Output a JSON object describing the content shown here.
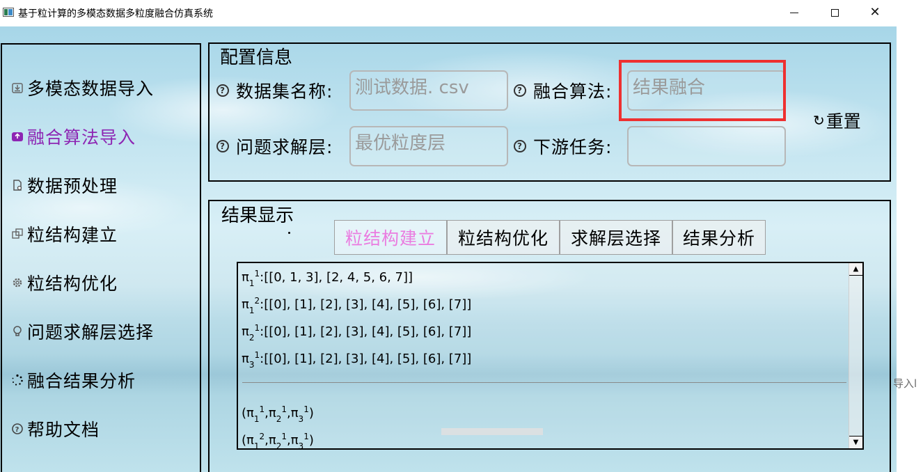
{
  "window": {
    "title": "基于粒计算的多模态数据多粒度融合仿真系统",
    "controls": {
      "minimize": "",
      "maximize": "",
      "close": "✕"
    }
  },
  "nav": {
    "items": [
      {
        "label": "多模态数据导入",
        "icon": "import-icon",
        "active": false
      },
      {
        "label": "融合算法导入",
        "icon": "upload-icon",
        "active": true
      },
      {
        "label": "数据预处理",
        "icon": "file-process-icon",
        "active": false
      },
      {
        "label": "粒结构建立",
        "icon": "structure-icon",
        "active": false
      },
      {
        "label": "粒结构优化",
        "icon": "gear-icon",
        "active": false
      },
      {
        "label": "问题求解层选择",
        "icon": "bulb-icon",
        "active": false
      },
      {
        "label": "融合结果分析",
        "icon": "loading-icon",
        "active": false
      },
      {
        "label": "帮助文档",
        "icon": "help-icon",
        "active": false
      }
    ]
  },
  "config": {
    "title": "配置信息",
    "fields": {
      "dataset": {
        "label": "数据集名称:",
        "value": "测试数据. csv"
      },
      "algorithm": {
        "label": "融合算法:",
        "value": "结果融合"
      },
      "layer": {
        "label": "问题求解层:",
        "value": "最优粒度层"
      },
      "task": {
        "label": "下游任务:",
        "value": ""
      }
    },
    "reset_label": "重置",
    "reset_icon": "↻",
    "highlight_color": "#ee3030"
  },
  "result": {
    "title": "结果显示",
    "tabs": [
      {
        "label": "粒结构建立",
        "active": true
      },
      {
        "label": "粒结构优化",
        "active": false
      },
      {
        "label": "求解层选择",
        "active": false
      },
      {
        "label": "结果分析",
        "active": false
      }
    ],
    "lines": [
      {
        "base": "π",
        "sub": "1",
        "sup": "1",
        "text": ":[[0, 1, 3], [2, 4, 5, 6, 7]]"
      },
      {
        "base": "π",
        "sub": "1",
        "sup": "2",
        "text": ":[[0], [1], [2], [3], [4], [5], [6], [7]]"
      },
      {
        "base": "π",
        "sub": "2",
        "sup": "1",
        "text": ":[[0], [1], [2], [3], [4], [5], [6], [7]]"
      },
      {
        "base": "π",
        "sub": "3",
        "sup": "1",
        "text": ":[[0], [1], [2], [3], [4], [5], [6], [7]]"
      }
    ],
    "combos": [
      {
        "parts": [
          {
            "sub": "1",
            "sup": "1"
          },
          {
            "sub": "2",
            "sup": "1"
          },
          {
            "sub": "3",
            "sup": "1"
          }
        ]
      },
      {
        "parts": [
          {
            "sub": "1",
            "sup": "2"
          },
          {
            "sub": "2",
            "sup": "1"
          },
          {
            "sub": "3",
            "sup": "1"
          }
        ]
      }
    ]
  },
  "clipped_text": "导入l",
  "colors": {
    "active_nav": "#8d25b3",
    "active_tab": "#ea7ce0",
    "placeholder": "#9a9a9a"
  }
}
